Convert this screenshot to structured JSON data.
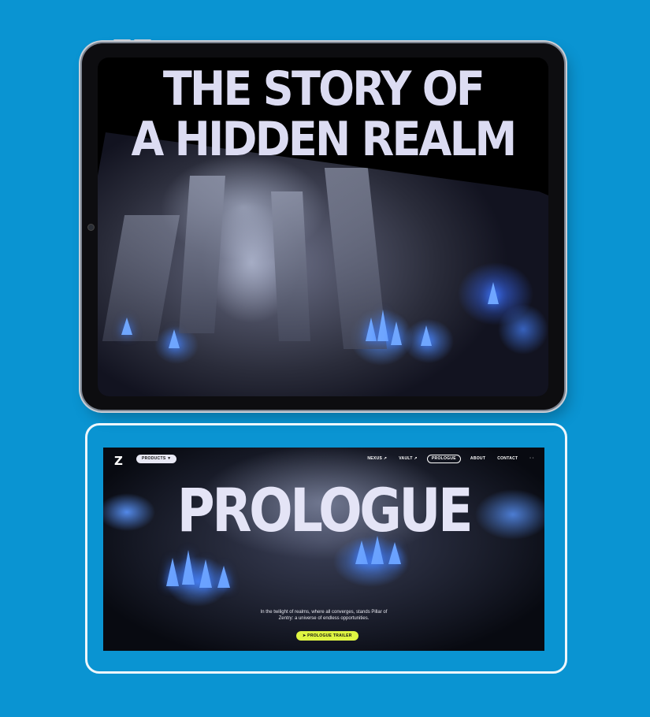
{
  "tablet": {
    "headline_line1": "THE STORY OF",
    "headline_line2": "A HIDDEN REALM"
  },
  "desktop": {
    "logo": "Z",
    "products_label": "PRODUCTS ▼",
    "nav": [
      {
        "label": "NEXUS ↗"
      },
      {
        "label": "VAULT ↗"
      },
      {
        "label": "PROLOGUE"
      },
      {
        "label": "ABOUT"
      },
      {
        "label": "CONTACT"
      },
      {
        "label": "· ·"
      }
    ],
    "hero_title": "PROLOGUE",
    "tagline": "In the twilight of realms, where all converges, stands Pillar of Zentry: a universe of endless opportunities.",
    "trailer_button": "➤ PROLOGUE TRAILER"
  },
  "colors": {
    "background": "#0a94d2",
    "accent": "#dff542",
    "headline": "#dcdcf2",
    "crystal": "#6fa6ff"
  }
}
